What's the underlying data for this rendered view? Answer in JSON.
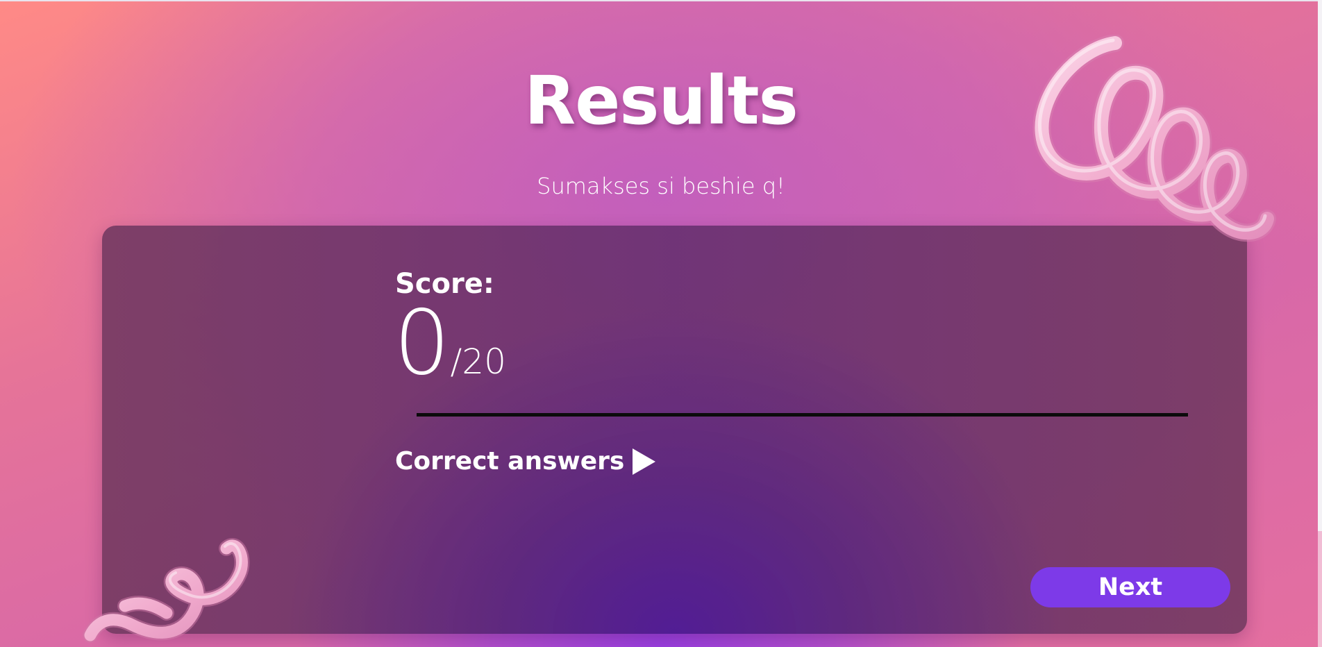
{
  "page": {
    "title": "Results",
    "subtitle": "Sumakses si beshie q!"
  },
  "result": {
    "score_label": "Score:",
    "score": "0",
    "total": "/20",
    "correct_answers_label": "Correct answers"
  },
  "actions": {
    "next_label": "Next"
  },
  "colors": {
    "accent_button": "#7d3ae8",
    "card_tint": "#6a3473",
    "background_top_left": "#ff8a86",
    "background_bottom_center": "#9a3fe0",
    "spiral_pink": "#f3b6d3"
  },
  "icons": {
    "expand": "play-triangle-icon",
    "decoration_top_right": "pink-spiral-decoration",
    "decoration_bottom_left": "pink-squiggle-decoration"
  }
}
